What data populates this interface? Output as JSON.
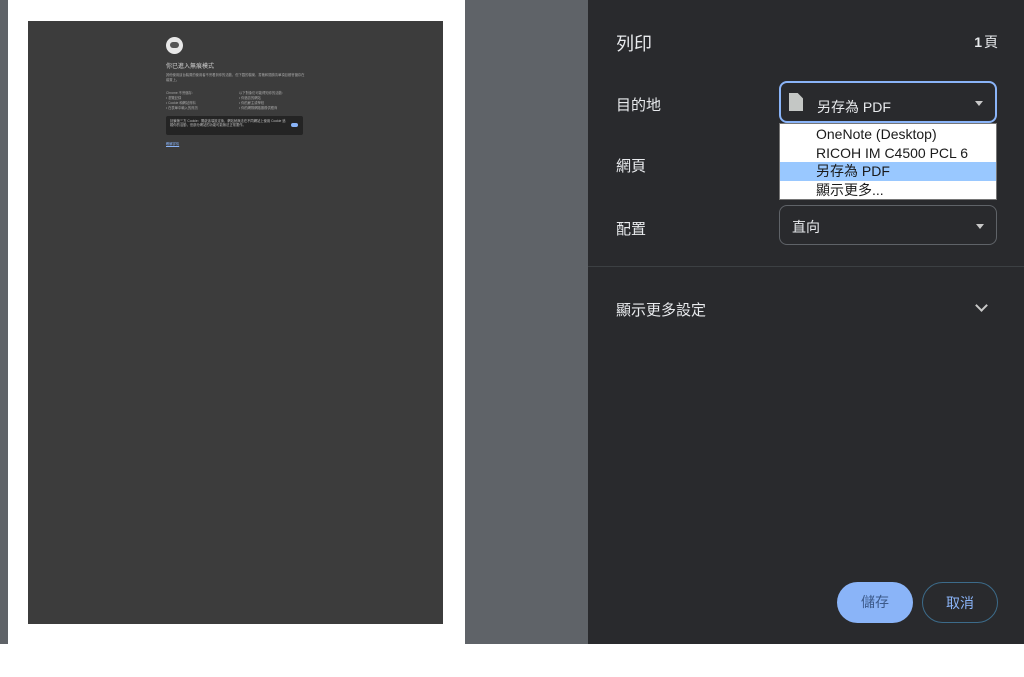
{
  "dialog": {
    "title": "列印",
    "page_count_num": "1",
    "page_count_unit": "頁"
  },
  "preview": {
    "heading": "你已進入無痕模式",
    "paragraph": "其他使用這台裝置的使用者不會看到你的活動，但下載的檔案、書籤和閱讀清單項目都會儲存在裝置上。",
    "col1": [
      "Chrome 不會儲存：",
      "• 瀏覽記錄",
      "• Cookie 和網站資料",
      "• 在表單中輸入的資訊"
    ],
    "col2": [
      "以下對象仍可能得知你的活動：",
      "• 你造訪的網站",
      "• 你的雇主或學校",
      "• 你的網際網路服務供應商"
    ],
    "box_text": "封鎖第三方 Cookie：開啟這項設定後，網站就無法在不同網站上使用 Cookie 追蹤你的活動，但部分網站的功能可能無法正常運作。",
    "link": "瞭解詳情"
  },
  "destination": {
    "label": "目的地",
    "selected": "另存為 PDF",
    "options": [
      "OneNote (Desktop)",
      "RICOH IM C4500 PCL 6",
      "另存為 PDF",
      "顯示更多..."
    ],
    "selected_index": 2
  },
  "pages": {
    "label": "網頁"
  },
  "layout": {
    "label": "配置",
    "value": "直向"
  },
  "more_settings": {
    "label": "顯示更多設定"
  },
  "buttons": {
    "save": "儲存",
    "cancel": "取消"
  },
  "colors": {
    "accent": "#8ab4f8",
    "panel_bg": "#292a2d",
    "preview_bg": "#5f6368",
    "selected_option": "#99c8ff"
  }
}
